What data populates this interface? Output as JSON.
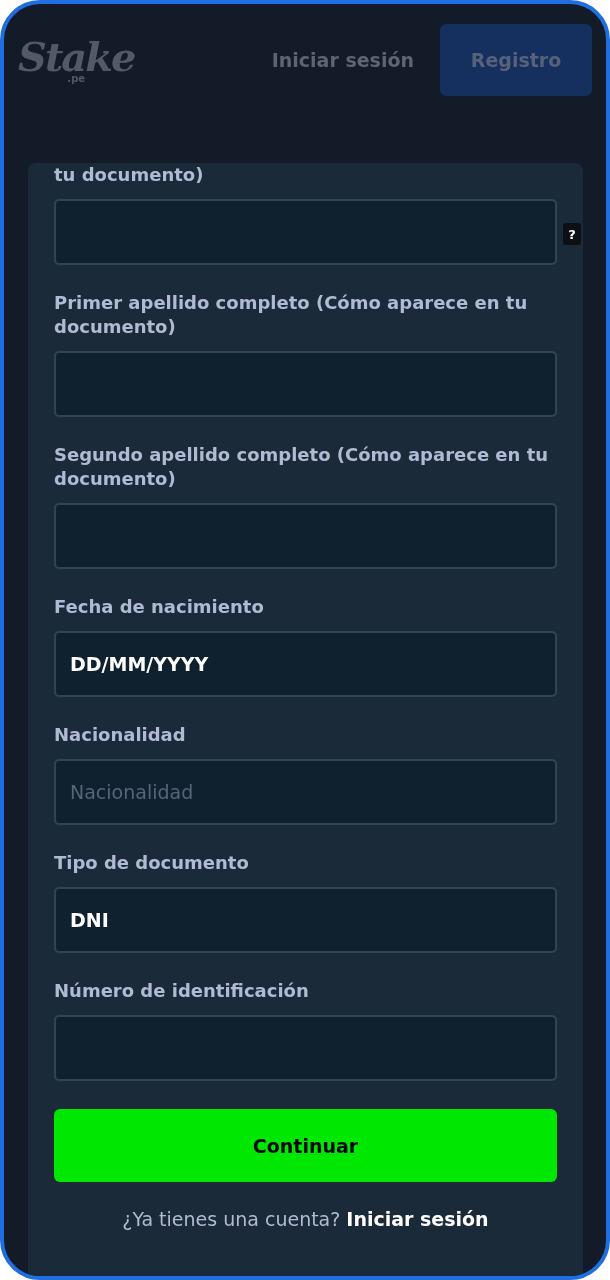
{
  "header": {
    "logo": "Stake",
    "logo_suffix": ".pe",
    "login": "Iniciar sesión",
    "register": "Registro"
  },
  "form": {
    "fields": [
      {
        "label": "tu documento)",
        "help": "?"
      },
      {
        "label": "Primer apellido completo (Cómo aparece en tu documento)"
      },
      {
        "label": "Segundo apellido completo (Cómo aparece en tu documento)"
      },
      {
        "label": "Fecha de nacimiento",
        "value": "DD/MM/YYYY"
      },
      {
        "label": "Nacionalidad",
        "placeholder": "Nacionalidad"
      },
      {
        "label": "Tipo de documento",
        "value": "DNI"
      },
      {
        "label": "Número de identificación"
      }
    ],
    "submit": "Continuar",
    "account_prompt": "¿Ya tienes una cuenta?",
    "account_link": "Iniciar sesión"
  }
}
